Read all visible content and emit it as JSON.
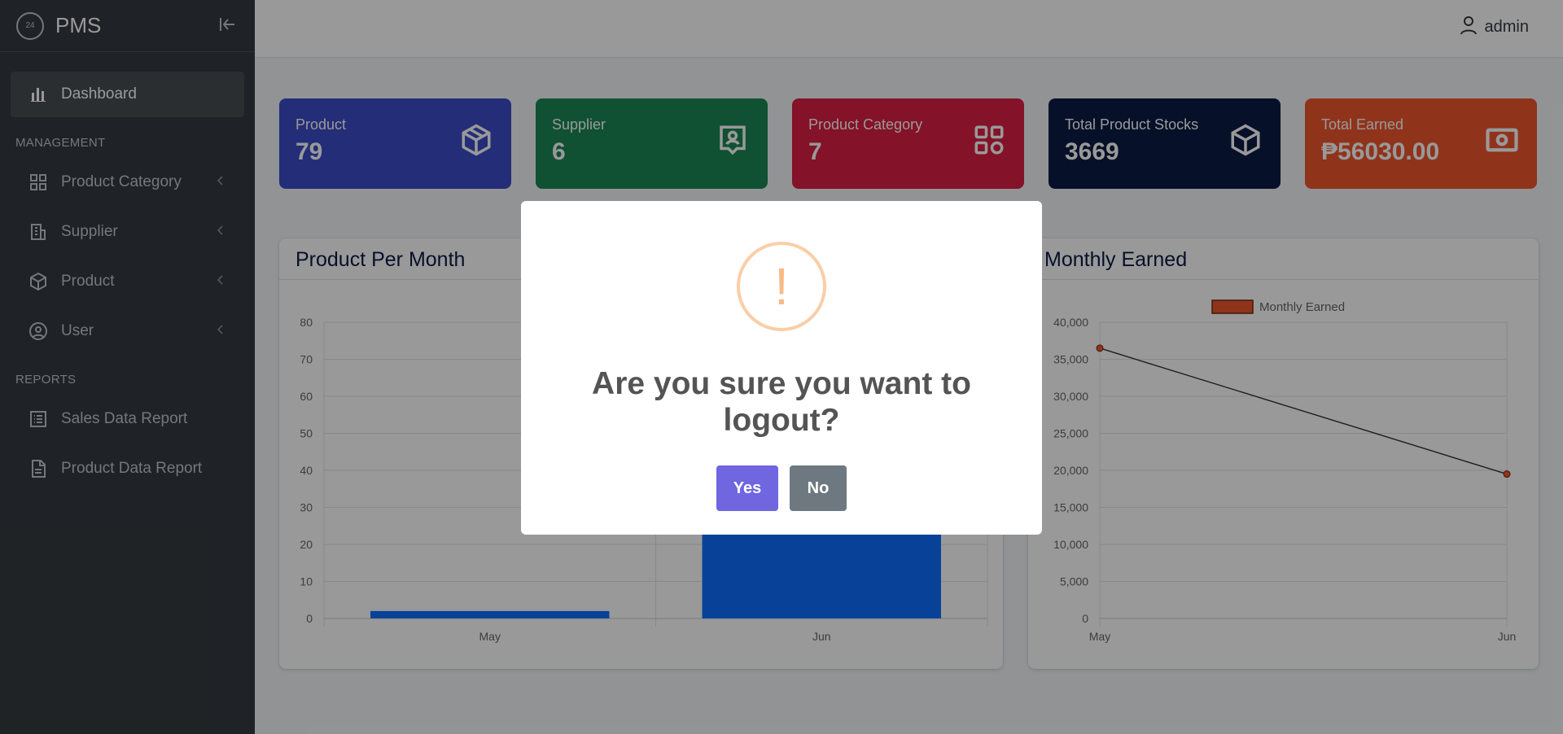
{
  "brand": {
    "name": "PMS",
    "logo_text": "24"
  },
  "sidebar": {
    "items": [
      {
        "label": "Dashboard",
        "icon": "bar-chart-icon",
        "active": true
      }
    ],
    "management_header": "MANAGEMENT",
    "management_items": [
      {
        "label": "Product Category",
        "icon": "grid-icon"
      },
      {
        "label": "Supplier",
        "icon": "building-icon"
      },
      {
        "label": "Product",
        "icon": "box-icon"
      },
      {
        "label": "User",
        "icon": "user-circle-icon"
      }
    ],
    "reports_header": "REPORTS",
    "reports_items": [
      {
        "label": "Sales Data Report",
        "icon": "list-icon"
      },
      {
        "label": "Product Data Report",
        "icon": "document-icon"
      }
    ]
  },
  "topbar": {
    "username": "admin"
  },
  "cards": [
    {
      "label": "Product",
      "value": "79",
      "color": "#3d4cc6",
      "icon": "box-icon"
    },
    {
      "label": "Supplier",
      "value": "6",
      "color": "#198754",
      "icon": "contact-icon"
    },
    {
      "label": "Product Category",
      "value": "7",
      "color": "#dc1f44",
      "icon": "grid-icon"
    },
    {
      "label": "Total Product Stocks",
      "value": "3669",
      "color": "#0b1b45",
      "icon": "cube-icon"
    },
    {
      "label": "Total Earned",
      "value": "₱56030.00",
      "color": "#f0562e",
      "icon": "cash-icon"
    }
  ],
  "panels": {
    "left_title": "Product Per Month",
    "right_title": "Monthly Earned"
  },
  "chart_data": [
    {
      "type": "bar",
      "title": "Product Per Month",
      "categories": [
        "May",
        "Jun"
      ],
      "series": [
        {
          "values": [
            2,
            76
          ],
          "color": "#0d6efd"
        }
      ],
      "ylim": [
        0,
        80
      ],
      "yticks": [
        0,
        10,
        20,
        30,
        40,
        50,
        60,
        70,
        80
      ],
      "grid": true
    },
    {
      "type": "line",
      "title": "Monthly Earned",
      "categories": [
        "May",
        "Jun"
      ],
      "series": [
        {
          "name": "Monthly Earned",
          "values": [
            36500,
            19500
          ],
          "color": "#f0562e"
        }
      ],
      "ylim": [
        0,
        40000
      ],
      "yticks": [
        "0",
        "5,000",
        "10,000",
        "15,000",
        "20,000",
        "25,000",
        "30,000",
        "35,000",
        "40,000"
      ],
      "legend": "top-center",
      "grid": true
    }
  ],
  "modal": {
    "icon_glyph": "!",
    "title": "Are you sure you want to logout?",
    "yes_label": "Yes",
    "no_label": "No",
    "yes_color": "#7066e0",
    "no_color": "#6e7881"
  }
}
